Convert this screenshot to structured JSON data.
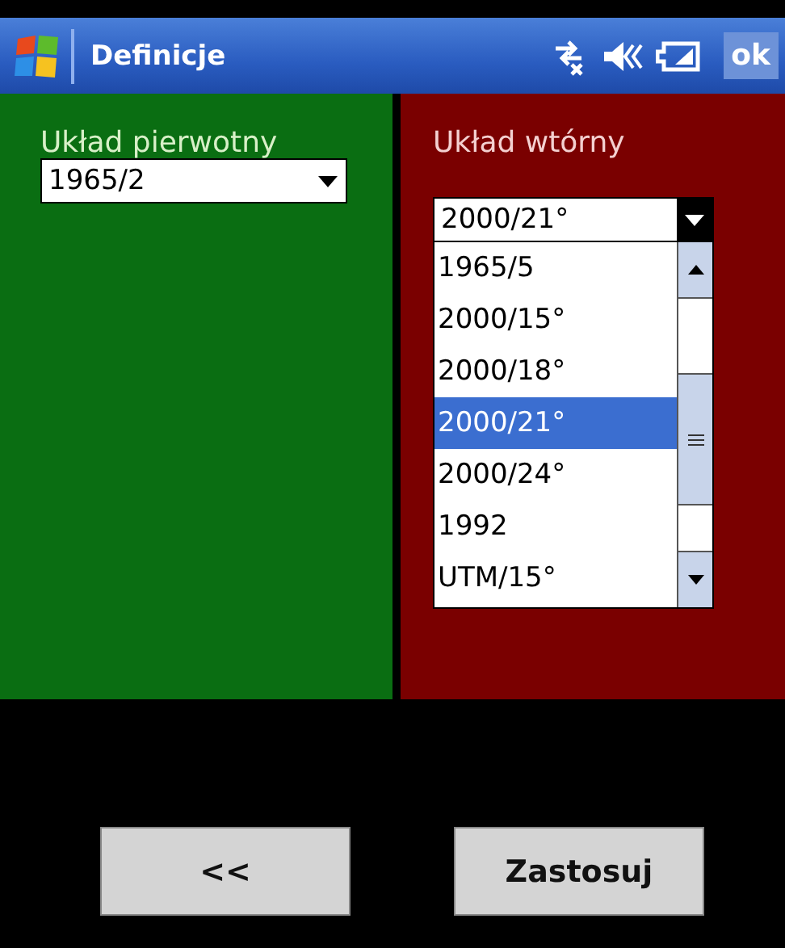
{
  "window": {
    "title": "Definicje",
    "ok": "ok"
  },
  "primary": {
    "label": "Układ pierwotny",
    "value": "1965/2",
    "expanded": false
  },
  "secondary": {
    "label": "Układ wtórny",
    "value": "2000/21°",
    "expanded": true,
    "options": [
      {
        "label": "1965/5",
        "selected": false
      },
      {
        "label": "2000/15°",
        "selected": false
      },
      {
        "label": "2000/18°",
        "selected": false
      },
      {
        "label": "2000/21°",
        "selected": true
      },
      {
        "label": "2000/24°",
        "selected": false
      },
      {
        "label": "1992",
        "selected": false
      },
      {
        "label": "UTM/15°",
        "selected": false
      }
    ]
  },
  "buttons": [
    "<<",
    "Zastosuj"
  ]
}
